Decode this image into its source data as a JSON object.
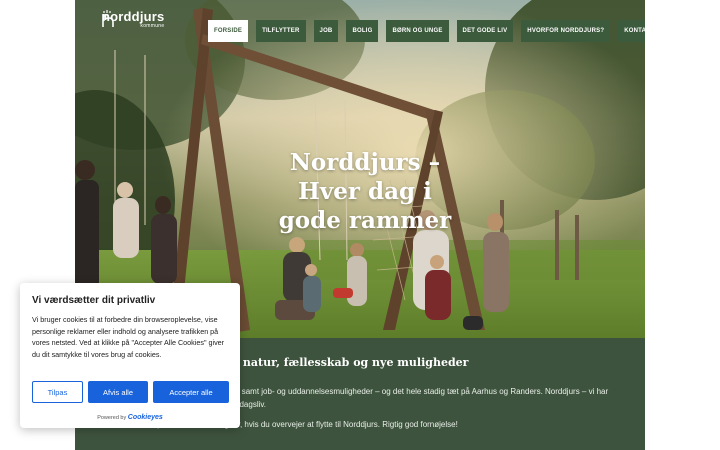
{
  "brand": {
    "name": "norddjurs",
    "sub": "kommune",
    "accent": "#3c5a3c",
    "content_bg": "#3e533e"
  },
  "nav": {
    "items": [
      {
        "label": "FORSIDE",
        "active": true
      },
      {
        "label": "TILFLYTTER"
      },
      {
        "label": "JOB"
      },
      {
        "label": "BOLIG"
      },
      {
        "label": "BØRN OG UNGE"
      },
      {
        "label": "DET GODE LIV"
      },
      {
        "label": "HVORFOR NORDDJURS?"
      },
      {
        "label": "KONTAKT"
      }
    ]
  },
  "hero": {
    "line1": "Norddjurs –",
    "line2": "Hver dag i",
    "line3": "gode rammer"
  },
  "content": {
    "heading": "ddjurs – tæt på natur, fællesskab og nye muligheder",
    "paragraph1": "ttraktive boligpriser, skoler samt job- og uddannelsesmuligheder – og det hele stadig tæt på Aarhus og Randers. Norddjurs – vi har rammerne for et godt hverdagsliv.",
    "paragraph2": "inspiration, du har brug for, hvis du overvejer at flytte til Norddjurs. Rigtig god fornøjelse!"
  },
  "cookie": {
    "title": "Vi værdsætter dit privatliv",
    "text": "Vi bruger cookies til at forbedre din browseroplevelse, vise personlige reklamer eller indhold og analysere trafikken på vores netsted. Ved at klikke på \"Accepter Alle Cookies\" giver du dit samtykke til vores brug af cookies.",
    "customize_label": "Tilpas",
    "reject_label": "Afvis alle",
    "accept_label": "Accepter alle",
    "powered_prefix": "Powered by",
    "powered_brand": "Cookieyes",
    "button_color": "#1863dc"
  }
}
